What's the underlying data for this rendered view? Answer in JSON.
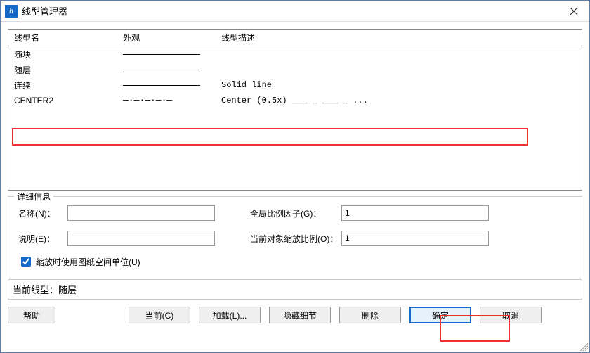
{
  "window": {
    "title": "线型管理器"
  },
  "list": {
    "headers": {
      "name": "线型名",
      "appearance": "外观",
      "desc": "线型描述"
    },
    "rows": [
      {
        "name": "随块",
        "appearance": "solid",
        "desc": ""
      },
      {
        "name": "随层",
        "appearance": "solid",
        "desc": ""
      },
      {
        "name": "连续",
        "appearance": "solid",
        "desc": "Solid line"
      },
      {
        "name": "CENTER2",
        "appearance": "dash",
        "dash_pattern": "—·—·—·—·—",
        "desc": "Center (0.5x) ___ _ ___ _ ..."
      }
    ]
  },
  "details": {
    "legend": "详细信息",
    "name_label": "名称(N)：",
    "name_value": "",
    "desc_label": "说明(E)：",
    "desc_value": "",
    "global_scale_label": "全局比例因子(G)：",
    "global_scale_value": "1",
    "object_scale_label": "当前对象缩放比例(O)：",
    "object_scale_value": "1",
    "paperspace_checkbox": "缩放时使用图纸空间单位(U)",
    "paperspace_checked": true
  },
  "current": {
    "label": "当前线型：",
    "value": "随层"
  },
  "buttons": {
    "help": "帮助",
    "current": "当前(C)",
    "load": "加载(L)...",
    "hide_details": "隐藏细节",
    "delete": "删除",
    "ok": "确定",
    "cancel": "取消"
  }
}
